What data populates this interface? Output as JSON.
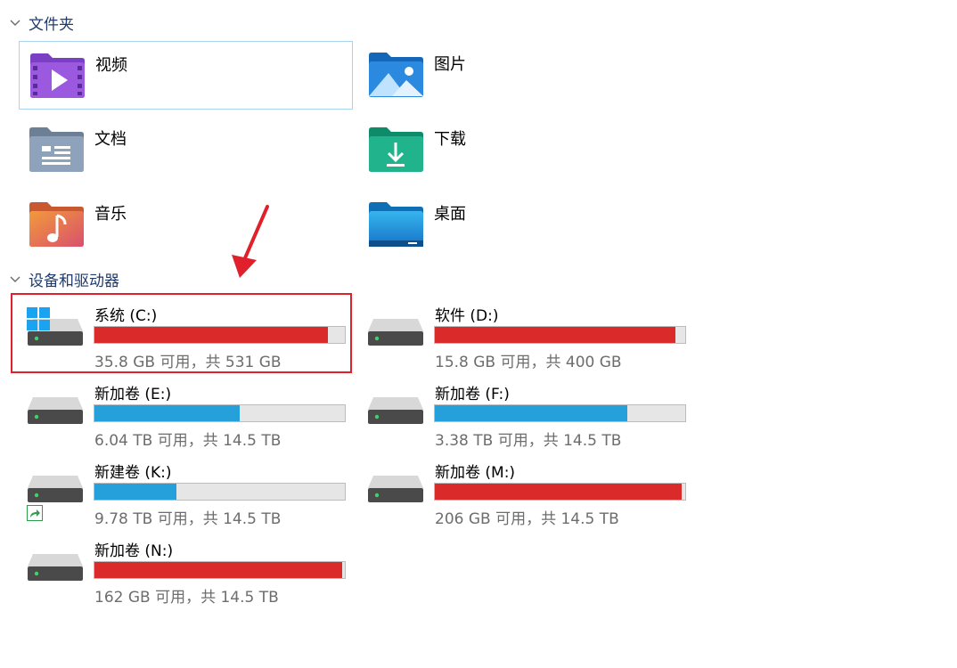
{
  "folders_section": {
    "title": "文件夹",
    "items": [
      {
        "name": "视频",
        "icon": "videos-folder-icon"
      },
      {
        "name": "图片",
        "icon": "pictures-folder-icon"
      },
      {
        "name": "文档",
        "icon": "documents-folder-icon"
      },
      {
        "name": "下载",
        "icon": "downloads-folder-icon"
      },
      {
        "name": "音乐",
        "icon": "music-folder-icon"
      },
      {
        "name": "桌面",
        "icon": "desktop-folder-icon"
      }
    ]
  },
  "drives_section": {
    "title": "设备和驱动器",
    "drives": [
      {
        "name": "系统 (C:)",
        "space": "35.8 GB 可用，共 531 GB",
        "used_fraction": 0.933,
        "bar_color": "#da2a2a"
      },
      {
        "name": "软件 (D:)",
        "space": "15.8 GB 可用，共 400 GB",
        "used_fraction": 0.96,
        "bar_color": "#da2a2a"
      },
      {
        "name": "新加卷 (E:)",
        "space": "6.04 TB 可用，共 14.5 TB",
        "used_fraction": 0.58,
        "bar_color": "#26a0da"
      },
      {
        "name": "新加卷 (F:)",
        "space": "3.38 TB 可用，共 14.5 TB",
        "used_fraction": 0.77,
        "bar_color": "#26a0da"
      },
      {
        "name": "新建卷 (K:)",
        "space": "9.78 TB 可用，共 14.5 TB",
        "used_fraction": 0.326,
        "bar_color": "#26a0da"
      },
      {
        "name": "新加卷 (M:)",
        "space": "206 GB 可用，共 14.5 TB",
        "used_fraction": 0.986,
        "bar_color": "#da2a2a"
      },
      {
        "name": "新加卷 (N:)",
        "space": "162 GB 可用，共 14.5 TB",
        "used_fraction": 0.989,
        "bar_color": "#da2a2a"
      }
    ]
  },
  "annotation": {
    "color": "#e0202a"
  }
}
